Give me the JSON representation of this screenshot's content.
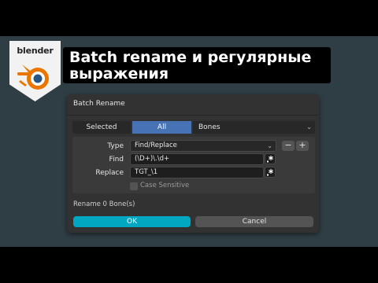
{
  "logo": {
    "text": "blender"
  },
  "title": {
    "line1": "Batch rename и регулярные",
    "line2": "выражения"
  },
  "dialog": {
    "title": "Batch Rename",
    "scope": {
      "options": [
        "Selected",
        "All"
      ],
      "active": "All"
    },
    "data_type": "Bones",
    "type_label": "Type",
    "type_value": "Find/Replace",
    "find_label": "Find",
    "find_value": "(\\D+)\\.\\d+",
    "replace_label": "Replace",
    "replace_value": "TGT_\\1",
    "case_sensitive_label": "Case Sensitive",
    "rename_info": "Rename 0 Bone(s)",
    "ok_label": "OK",
    "cancel_label": "Cancel"
  },
  "colors": {
    "accent_blue": "#4772b3",
    "ok_button": "#00a7c0",
    "blender_orange": "#ea7600",
    "blender_blue": "#265787"
  }
}
